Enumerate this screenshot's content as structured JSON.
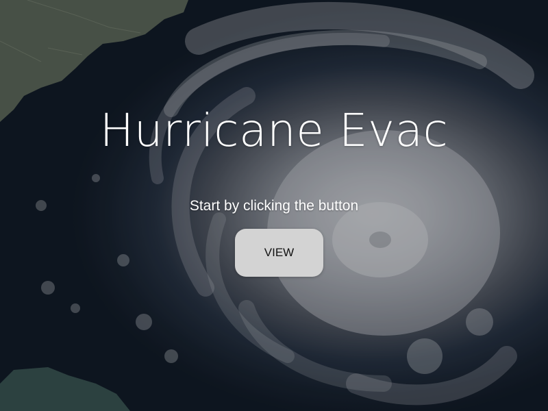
{
  "page": {
    "title": "Hurricane Evac",
    "subtitle": "Start by clicking the button",
    "button_label": "VIEW"
  },
  "background": {
    "image": "satellite-hurricane-image",
    "overlay": "dark-tint"
  },
  "colors": {
    "text": "#ffffff",
    "button_bg": "#d3d3d3",
    "button_text": "#111111",
    "ocean_dark": "#111a26",
    "cloud_light": "#b9bcc1",
    "land": "#5f6b5c"
  }
}
